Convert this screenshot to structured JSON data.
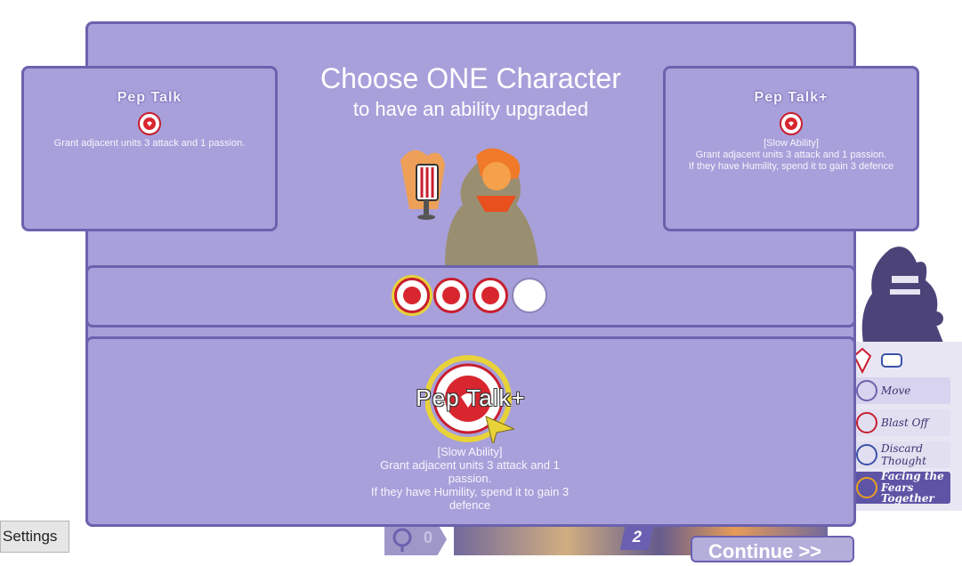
{
  "modal": {
    "title": "Choose ONE Character",
    "subtitle": "to have an ability upgraded"
  },
  "current_card": {
    "name": "Pep Talk",
    "icon": "passion-heart-icon",
    "description": "Grant adjacent units 3 attack and 1 passion."
  },
  "upgraded_card": {
    "name": "Pep Talk+",
    "icon": "passion-heart-icon",
    "tag": "[Slow Ability]",
    "line1": "Grant adjacent units 3 attack and 1 passion.",
    "line2": "If they have Humility, spend it to gain 3 defence"
  },
  "passion_slots": [
    {
      "filled": true,
      "selected": true
    },
    {
      "filled": true,
      "selected": false
    },
    {
      "filled": true,
      "selected": false
    },
    {
      "filled": false,
      "selected": false
    }
  ],
  "selected_ability": {
    "name": "Pep Talk+",
    "tag": "[Slow Ability]",
    "line1": "Grant adjacent units 3 attack and 1",
    "line2": "passion.",
    "line3": "If they have Humility, spend it to gain 3",
    "line4": "defence"
  },
  "side_panel": {
    "actions": [
      "Move",
      "Blast Off",
      "Discard Thought",
      "Facing the Fears Together"
    ]
  },
  "hud": {
    "humility_count": "0",
    "turn_number": "2"
  },
  "buttons": {
    "settings": "Settings",
    "continue": "Continue >>"
  },
  "colors": {
    "panel": "#a8a0da",
    "panel_border": "#6b62ae",
    "passion_red": "#d8262f",
    "select_yellow": "#e8d23a"
  }
}
